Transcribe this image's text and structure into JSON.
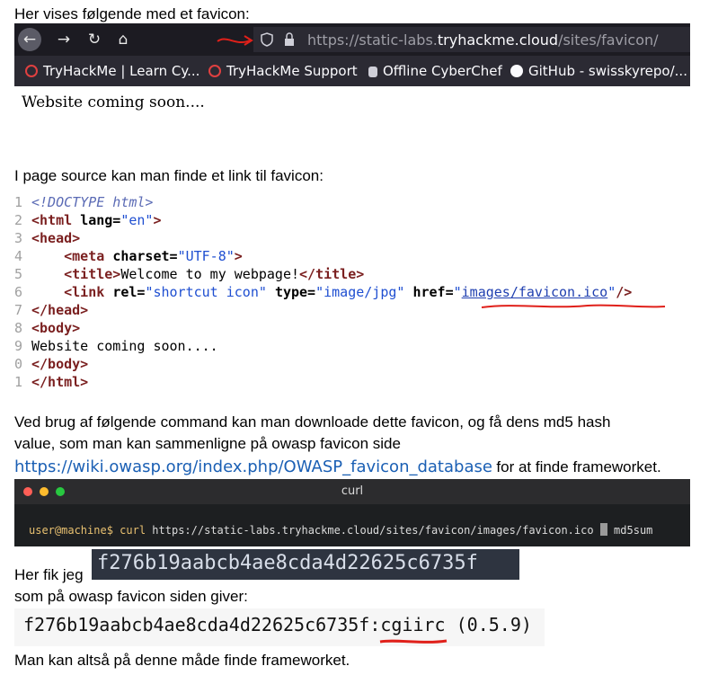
{
  "intro": "Her vises følgende med et favicon:",
  "browser": {
    "url_prefix": "https://static-labs.",
    "url_domain": "tryhackme.cloud",
    "url_path": "/sites/favicon/",
    "bookmarks": [
      "TryHackMe | Learn Cy...",
      "TryHackMe Support",
      "Offline CyberChef",
      "GitHub - swisskyrepo/..."
    ],
    "page_text": "Website coming soon...."
  },
  "source_intro": "I page source kan man finde et link til favicon:",
  "source": {
    "line_numbers": [
      "1",
      "2",
      "3",
      "4",
      "5",
      "6",
      "7",
      "8",
      "9",
      "0",
      "1"
    ],
    "doctype": "<!DOCTYPE html>",
    "html_open_tag": "<html",
    "lang_attr": "lang=",
    "lang_value": "\"en\"",
    "gt": ">",
    "head_open": "<head>",
    "meta_tag": "<meta",
    "charset_attr": "charset=",
    "charset_value": "\"UTF-8\"",
    "title_open": "<title>",
    "title_text": "Welcome to my webpage!",
    "title_close": "</title>",
    "link_tag": "<link",
    "rel_attr": "rel=",
    "rel_value": "\"shortcut icon\"",
    "type_attr": "type=",
    "type_value": "\"image/jpg\"",
    "href_attr": "href=",
    "quote": "\"",
    "href_value": "images/favicon.ico",
    "close_self": "/>",
    "head_close": "</head>",
    "body_open": "<body>",
    "body_text": "Website coming soon....",
    "body_close": "</body>",
    "html_close": "</html>"
  },
  "command_intro_1": "Ved brug af følgende command kan man downloade dette favicon, og få dens md5 hash",
  "command_intro_2": "value, som man kan sammenligne på owasp favicon side",
  "owasp_link": "https://wiki.owasp.org/index.php/OWASP_favicon_database",
  "link_suffix": "for at finde frameworket.",
  "terminal": {
    "title": "curl",
    "prompt": "user@machine$",
    "command": "curl",
    "args": "https://static-labs.tryhackme.cloud/sites/favicon/images/favicon.ico",
    "pipe_target": "md5sum"
  },
  "got_label": "Her fik jeg",
  "hash": "f276b19aabcb4ae8cda4d22625c6735f",
  "owasp_intro": "som på owasp favicon siden giver:",
  "owasp_result": "f276b19aabcb4ae8cda4d22625c6735f:cgiirc (0.5.9)",
  "conclusion": "Man kan altså på denne måde finde frameworket.",
  "colors": {
    "annotation_red": "#e0201a",
    "link_blue": "#1a5fb4"
  }
}
